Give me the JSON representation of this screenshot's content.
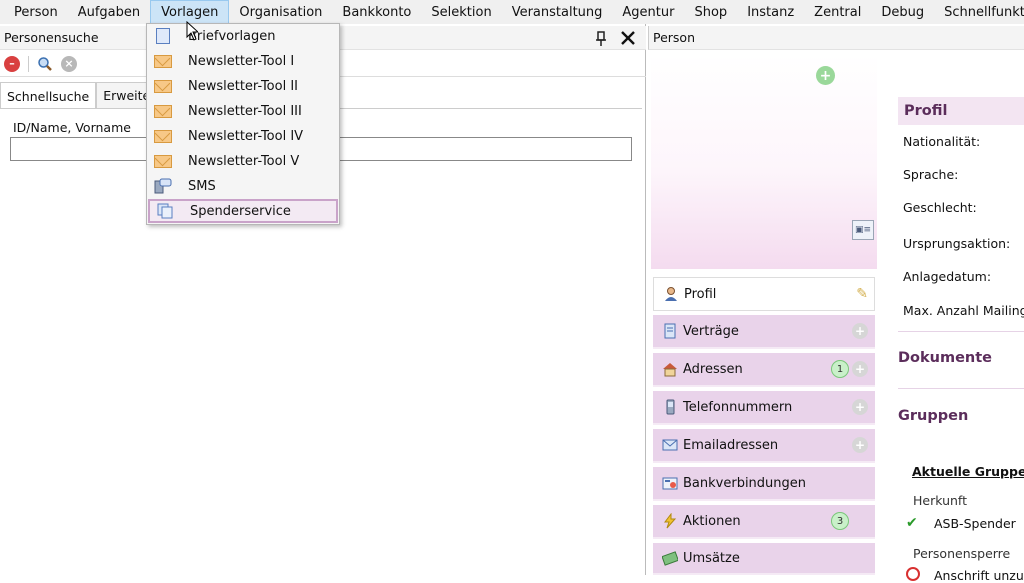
{
  "menubar": [
    "Person",
    "Aufgaben",
    "Vorlagen",
    "Organisation",
    "Bankkonto",
    "Selektion",
    "Veranstaltung",
    "Agentur",
    "Shop",
    "Instanz",
    "Zentral",
    "Debug",
    "Schnellfunktionen"
  ],
  "left": {
    "title": "Personensuche",
    "tabs": [
      "Schnellsuche",
      "Erweiter"
    ],
    "field_label": "ID/Name, Vorname",
    "field_value": ""
  },
  "dropdown": [
    {
      "label": "Briefvorlagen",
      "icon": "document-icon"
    },
    {
      "label": "Newsletter-Tool I",
      "icon": "envelope-icon"
    },
    {
      "label": "Newsletter-Tool II",
      "icon": "envelope-icon"
    },
    {
      "label": "Newsletter-Tool III",
      "icon": "envelope-icon"
    },
    {
      "label": "Newsletter-Tool IV",
      "icon": "envelope-icon"
    },
    {
      "label": "Newsletter-Tool V",
      "icon": "envelope-icon"
    },
    {
      "label": "SMS",
      "icon": "sms-icon"
    },
    {
      "label": "Spenderservice",
      "icon": "copy-icon"
    }
  ],
  "right": {
    "title": "Person",
    "nav": [
      {
        "label": "Profil",
        "icon": "person-icon"
      },
      {
        "label": "Verträge",
        "icon": "contract-icon"
      },
      {
        "label": "Adressen",
        "icon": "house-icon",
        "count": "1"
      },
      {
        "label": "Telefonnummern",
        "icon": "phone-icon"
      },
      {
        "label": "Emailadressen",
        "icon": "mail-icon"
      },
      {
        "label": "Bankverbindungen",
        "icon": "bank-icon"
      },
      {
        "label": "Aktionen",
        "icon": "lightning-icon",
        "count": "3"
      },
      {
        "label": "Umsätze",
        "icon": "money-icon"
      }
    ],
    "profile": {
      "heading": "Profil",
      "fields": [
        "Nationalität:",
        "Sprache:",
        "Geschlecht:",
        "Ursprungsaktion:",
        "Anlagedatum:",
        "Max. Anzahl Mailing"
      ]
    },
    "documents_heading": "Dokumente",
    "groups_heading": "Gruppen",
    "current_groups": "Aktuelle Gruppen",
    "origin_label": "Herkunft",
    "origin_value": "ASB-Spender",
    "lock_label": "Personensperre",
    "lock_value": "Anschrift unzul"
  },
  "colors": {
    "accent": "#e9d3ea",
    "heading": "#5b2d5b",
    "menu_active": "#cce4f7"
  }
}
